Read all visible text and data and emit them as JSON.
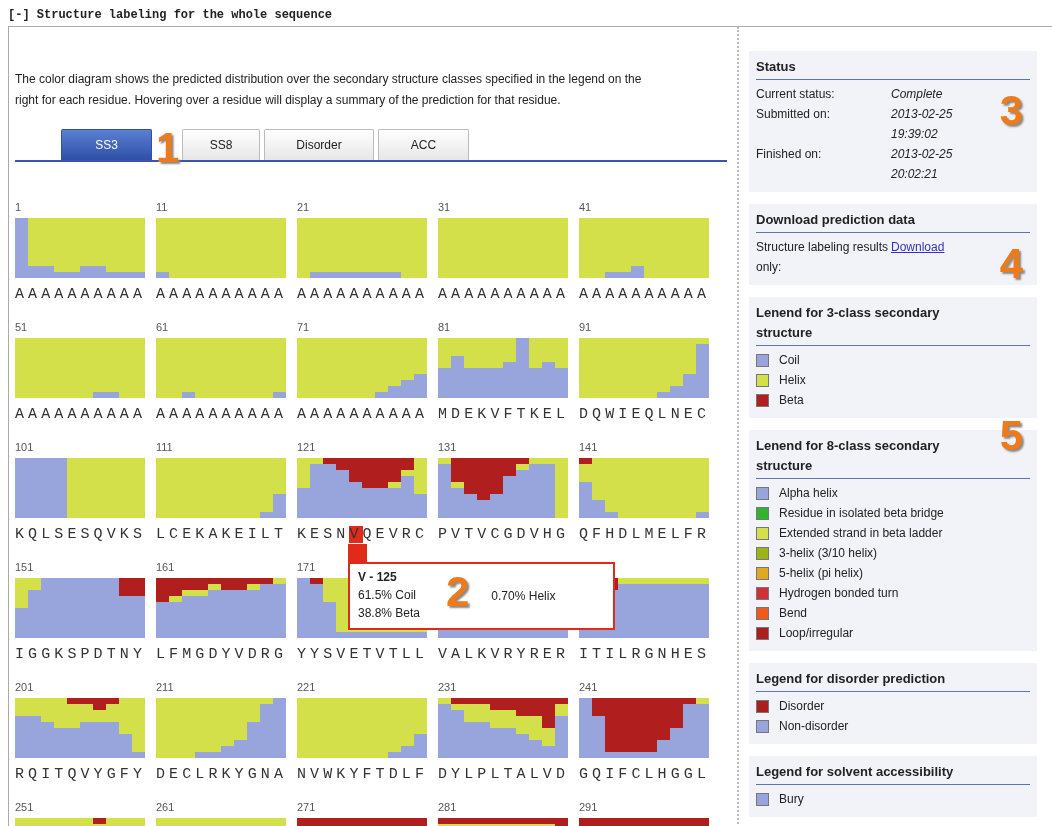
{
  "section_header": "[-] Structure labeling for the whole sequence",
  "description": "The color diagram shows the predicted distribution over the secondary structure classes specified in the legend on the right for each residue. Hovering over a residue will display a summary of the prediction for that residue.",
  "tabs": [
    {
      "label": "SS3",
      "selected": true
    },
    {
      "label": "SS8",
      "selected": false
    },
    {
      "label": "Disorder",
      "selected": false
    },
    {
      "label": "ACC",
      "selected": false
    }
  ],
  "tabs_callout": "1",
  "blocks": [
    {
      "start": "1",
      "sequence": "AAAAAAAAAA"
    },
    {
      "start": "11",
      "sequence": "AAAAAAAAAA"
    },
    {
      "start": "21",
      "sequence": "AAAAAAAAAA"
    },
    {
      "start": "31",
      "sequence": "AAAAAAAAAA"
    },
    {
      "start": "41",
      "sequence": "AAAAAAAAAA"
    },
    {
      "start": "51",
      "sequence": "AAAAAAAAAA"
    },
    {
      "start": "61",
      "sequence": "AAAAAAAAAA"
    },
    {
      "start": "71",
      "sequence": "AAAAAAAAAA"
    },
    {
      "start": "81",
      "sequence": "MDEKVFTKEL"
    },
    {
      "start": "91",
      "sequence": "DQWIEQLNEC"
    },
    {
      "start": "101",
      "sequence": "KQLSESQVKS"
    },
    {
      "start": "111",
      "sequence": "LCEKAKEILT"
    },
    {
      "start": "121",
      "sequence_before": "KESN",
      "highlighted_residue": "V",
      "sequence_after": "QEVRC"
    },
    {
      "start": "131",
      "sequence": "PVTVCGDVHG"
    },
    {
      "start": "141",
      "sequence": "QFHDLMELFR"
    },
    {
      "start": "151",
      "sequence": "IGGKSPDTNY"
    },
    {
      "start": "161",
      "sequence": "LFMGDYVDRG"
    },
    {
      "start": "171",
      "sequence": "YYSVETVTLL"
    },
    {
      "sequence": "VALKVRYRER"
    },
    {
      "sequence": "ITILRGNHES"
    },
    {
      "start": "201",
      "sequence": "RQITQVYGFY"
    },
    {
      "start": "211",
      "sequence": "DECLRKYGNA"
    },
    {
      "start": "221",
      "sequence": "NVWKYFTDLF"
    },
    {
      "start": "231",
      "sequence": "DYLPLTALVD"
    },
    {
      "start": "241",
      "sequence": "GQIFCLHGGL"
    },
    {
      "start": "251"
    },
    {
      "start": "261"
    },
    {
      "start": "271"
    },
    {
      "start": "281"
    },
    {
      "start": "291"
    }
  ],
  "tooltip": {
    "title": "V - 125",
    "coil": "61.5% Coil",
    "helix": "0.70% Helix",
    "beta": "38.8% Beta",
    "callout": "2"
  },
  "status": {
    "title": "Status",
    "callout": "3",
    "rows": [
      {
        "label": "Current status:",
        "value": "Complete"
      },
      {
        "label": "Submitted on:",
        "value": "2013-02-25 19:39:02"
      },
      {
        "label": "Finished on:",
        "value": "2013-02-25 20:02:21"
      }
    ]
  },
  "download": {
    "title": "Download prediction data",
    "label": "Structure labeling results only:",
    "link": "Download",
    "callout": "4"
  },
  "legends": [
    {
      "title": "Lenend for 3-class secondary structure",
      "callout": "5",
      "items": [
        {
          "label": "Coil",
          "color": "#98a4dc"
        },
        {
          "label": "Helix",
          "color": "#d4e04a"
        },
        {
          "label": "Beta",
          "color": "#b01e1e"
        }
      ]
    },
    {
      "title": "Lenend for 8-class secondary structure",
      "items": [
        {
          "label": "Alpha helix",
          "color": "#98a4dc"
        },
        {
          "label": "Residue in isolated beta bridge",
          "color": "#2eb42e"
        },
        {
          "label": "Extended strand in beta ladder",
          "color": "#d4e04a"
        },
        {
          "label": "3-helix (3/10 helix)",
          "color": "#9cb41a"
        },
        {
          "label": "5-helix (pi helix)",
          "color": "#e0aa20"
        },
        {
          "label": "Hydrogen bonded turn",
          "color": "#d03038"
        },
        {
          "label": "Bend",
          "color": "#f05a1e"
        },
        {
          "label": "Loop/irregular",
          "color": "#aa1e1e"
        }
      ]
    },
    {
      "title": "Legend for disorder prediction",
      "items": [
        {
          "label": "Disorder",
          "color": "#aa1e1e"
        },
        {
          "label": "Non-disorder",
          "color": "#98a4dc"
        }
      ]
    },
    {
      "title": "Legend for solvent accessibility",
      "items": [
        {
          "label": "Bury",
          "color": "#98a4dc"
        }
      ]
    }
  ]
}
